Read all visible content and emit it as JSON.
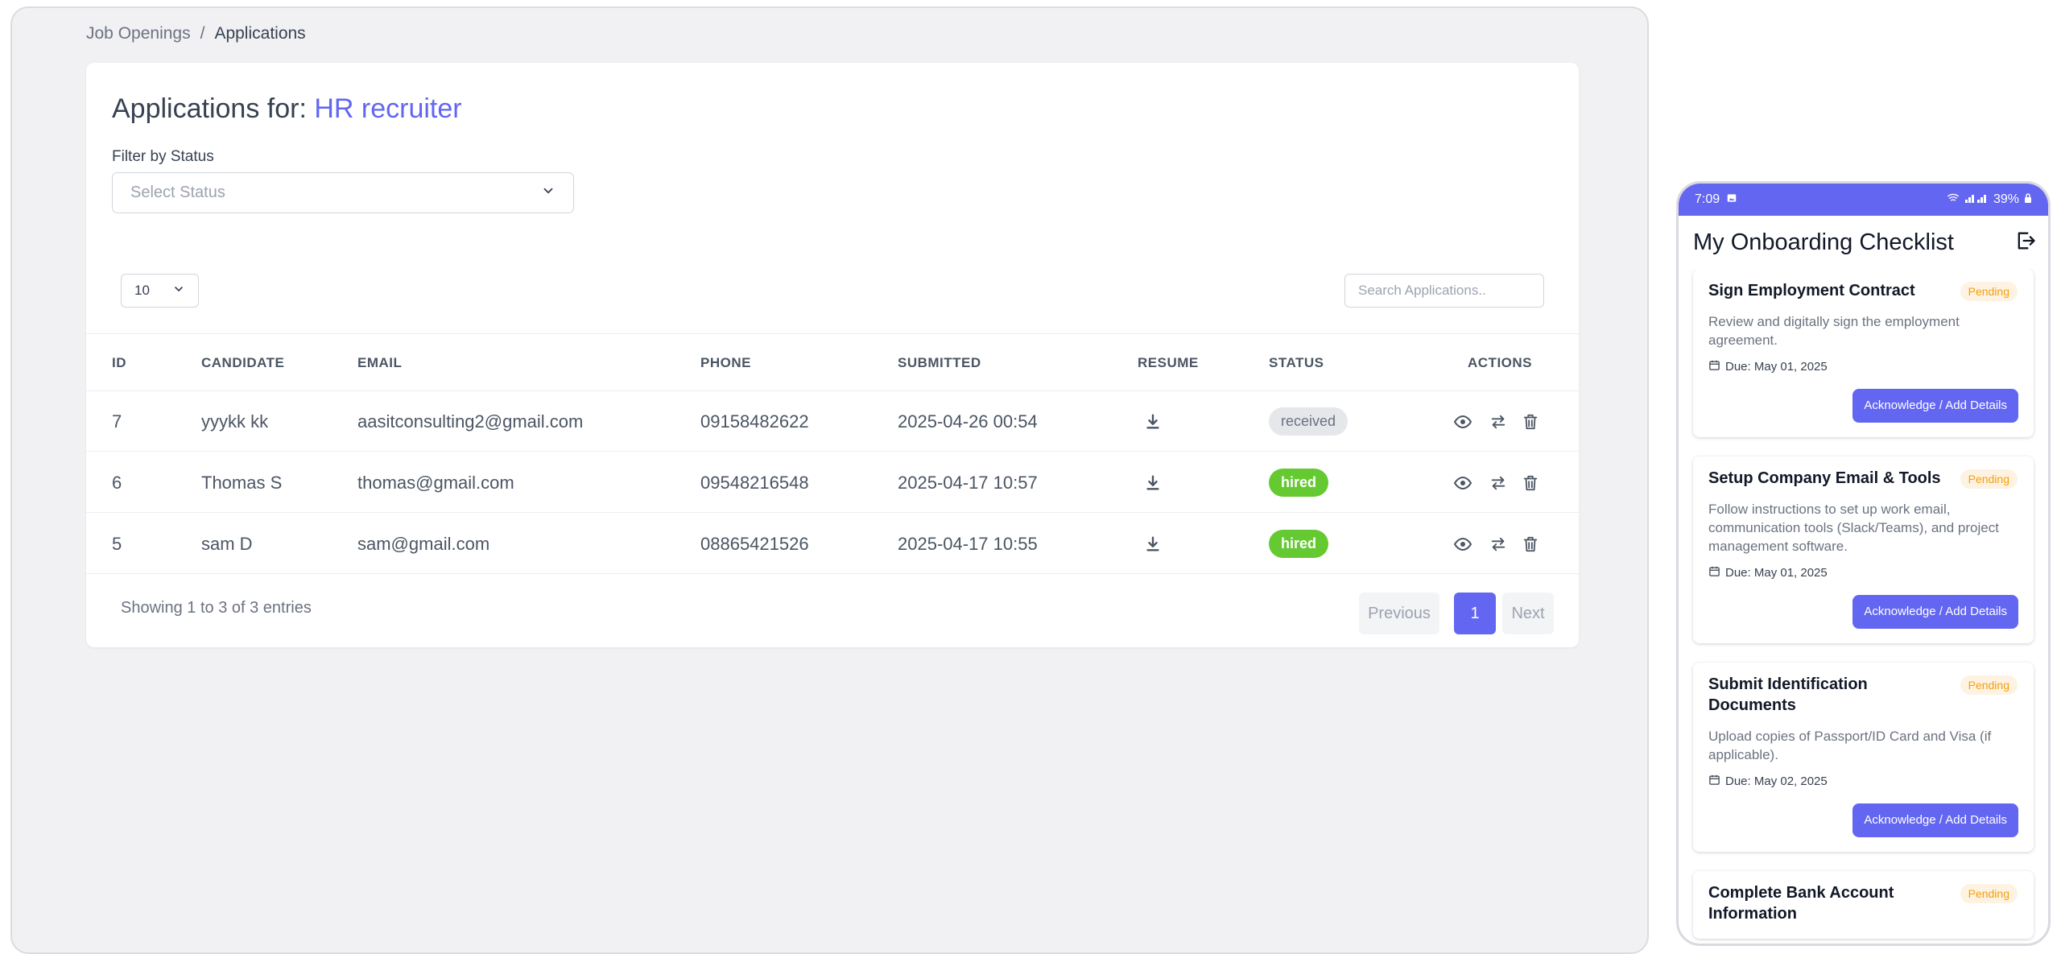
{
  "breadcrumb": {
    "parent": "Job Openings",
    "separator": "/",
    "current": "Applications"
  },
  "header": {
    "title_prefix": "Applications for:",
    "job_title": "HR recruiter"
  },
  "filter": {
    "label": "Filter by Status",
    "placeholder": "Select Status"
  },
  "table_controls": {
    "page_length": "10",
    "search_placeholder": "Search Applications.."
  },
  "columns": {
    "id": "ID",
    "candidate": "CANDIDATE",
    "email": "EMAIL",
    "phone": "PHONE",
    "submitted": "SUBMITTED",
    "resume": "RESUME",
    "status": "STATUS",
    "actions": "ACTIONS"
  },
  "rows": [
    {
      "id": "7",
      "candidate": "yyykk kk",
      "email": "aasitconsulting2@gmail.com",
      "phone": "09158482622",
      "submitted": "2025-04-26 00:54",
      "status": "received"
    },
    {
      "id": "6",
      "candidate": "Thomas S",
      "email": "thomas@gmail.com",
      "phone": "09548216548",
      "submitted": "2025-04-17 10:57",
      "status": "hired"
    },
    {
      "id": "5",
      "candidate": "sam D",
      "email": "sam@gmail.com",
      "phone": "08865421526",
      "submitted": "2025-04-17 10:55",
      "status": "hired"
    }
  ],
  "footer": {
    "showing": "Showing 1 to 3 of 3 entries",
    "previous": "Previous",
    "page": "1",
    "next": "Next"
  },
  "colors": {
    "accent": "#6366f1",
    "hired": "#65c932",
    "received_bg": "#e5e7eb",
    "pending": "#f59e0b"
  },
  "phone": {
    "status_time": "7:09",
    "battery": "39%",
    "title": "My Onboarding Checklist",
    "tasks": [
      {
        "title": "Sign Employment Contract",
        "status": "Pending",
        "description": "Review and digitally sign the employment agreement.",
        "due": "Due: May 01, 2025",
        "action": "Acknowledge / Add Details"
      },
      {
        "title": "Setup Company Email & Tools",
        "status": "Pending",
        "description": "Follow instructions to set up work email, communication tools (Slack/Teams), and project management software.",
        "due": "Due: May 01, 2025",
        "action": "Acknowledge / Add Details"
      },
      {
        "title": "Submit Identification Documents",
        "status": "Pending",
        "description": "Upload copies of Passport/ID Card and Visa (if applicable).",
        "due": "Due: May 02, 2025",
        "action": "Acknowledge / Add Details"
      },
      {
        "title": "Complete Bank Account Information",
        "status": "Pending"
      }
    ]
  }
}
